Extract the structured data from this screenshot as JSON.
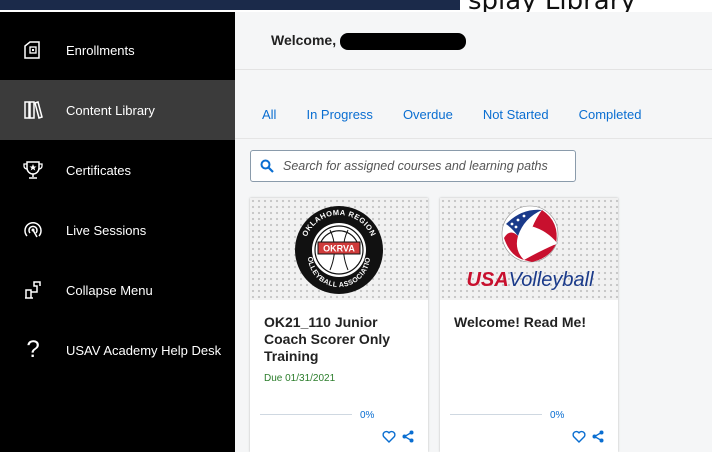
{
  "topbar": {
    "overflow_text": "splay Library"
  },
  "sidebar": {
    "items": [
      {
        "label": "Enrollments",
        "icon": "enrollments-icon"
      },
      {
        "label": "Content Library",
        "icon": "library-icon",
        "active": true
      },
      {
        "label": "Certificates",
        "icon": "trophy-icon"
      },
      {
        "label": "Live Sessions",
        "icon": "live-sessions-icon"
      },
      {
        "label": "Collapse Menu",
        "icon": "collapse-icon"
      },
      {
        "label": "USAV Academy Help Desk",
        "icon": "help-icon",
        "glyph": "?"
      }
    ]
  },
  "header": {
    "welcome": "Welcome,"
  },
  "tabs": [
    "All",
    "In Progress",
    "Overdue",
    "Not Started",
    "Completed"
  ],
  "search": {
    "placeholder": "Search for assigned courses and learning paths"
  },
  "cards": [
    {
      "title": "OK21_110 Junior Coach Scorer Only Training",
      "due": "Due 01/31/2021",
      "progress": "0%",
      "logo": {
        "ring_top": "OKLAHOMA REGION",
        "ring_bottom": "VOLLEYBALL ASSOCIATION",
        "badge": "OKRVA"
      }
    },
    {
      "title": "Welcome! Read Me!",
      "progress": "0%",
      "logo": {
        "brand_usa": "USA",
        "brand_rest": "Volleyball"
      }
    }
  ],
  "colors": {
    "accent": "#0a6ed1",
    "sidebar_bg": "#000000",
    "active_bg": "#3b3b3b",
    "due_green": "#2b7d2b",
    "okrva_red": "#d03b3b",
    "usa_blue": "#1a3a8a",
    "usa_red": "#c8102e"
  }
}
